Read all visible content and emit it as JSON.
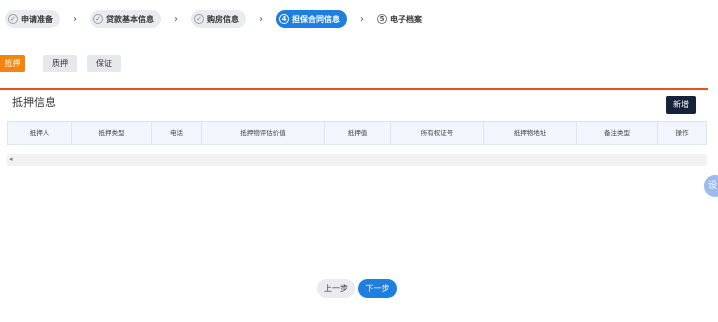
{
  "steps": [
    {
      "num": "✓",
      "label": "申请准备",
      "state": "done"
    },
    {
      "num": "✓",
      "label": "贷款基本信息",
      "state": "done"
    },
    {
      "num": "✓",
      "label": "购房信息",
      "state": "done"
    },
    {
      "num": "4",
      "label": "担保合同信息",
      "state": "active"
    },
    {
      "num": "5",
      "label": "电子档案",
      "state": "todo"
    }
  ],
  "tabs": [
    {
      "label": "抵押",
      "active": true
    },
    {
      "label": "质押",
      "active": false
    },
    {
      "label": "保证",
      "active": false
    }
  ],
  "section": {
    "title": "抵押信息",
    "add_label": "新增"
  },
  "table": {
    "columns": [
      "抵押人",
      "抵押类型",
      "电话",
      "抵押物评估价值",
      "抵押值",
      "所有权证号",
      "抵押物地址",
      "备注类型",
      "操作"
    ]
  },
  "scrollbar": {
    "left_arrow": "◂"
  },
  "float_button": {
    "label": "设"
  },
  "footer": {
    "prev_label": "上一步",
    "next_label": "下一步"
  },
  "colors": {
    "primary": "#1e7fe0",
    "orange": "#f5840c",
    "divider": "#e8511c",
    "dark_button": "#16233a"
  }
}
